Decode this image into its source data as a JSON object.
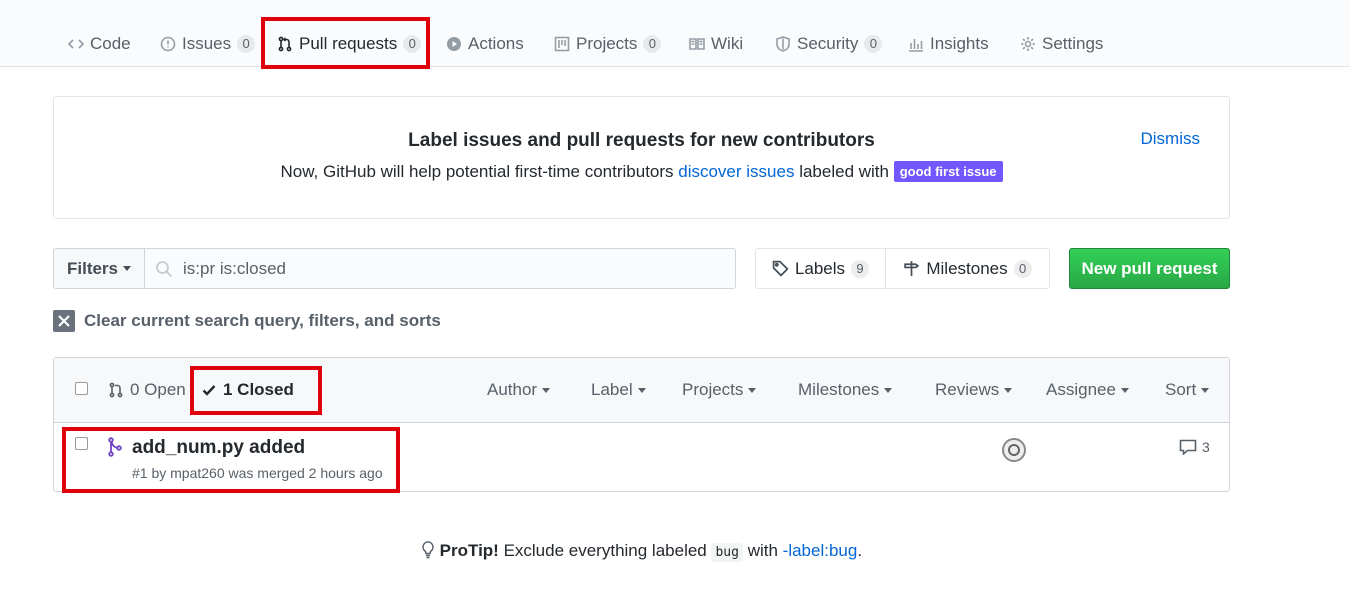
{
  "nav": {
    "tabs": [
      {
        "label": "Code",
        "icon": "code-icon"
      },
      {
        "label": "Issues",
        "count": "0",
        "icon": "issue-icon"
      },
      {
        "label": "Pull requests",
        "count": "0",
        "icon": "pull-request-icon",
        "selected": true
      },
      {
        "label": "Actions",
        "icon": "play-icon"
      },
      {
        "label": "Projects",
        "count": "0",
        "icon": "project-icon"
      },
      {
        "label": "Wiki",
        "icon": "book-icon"
      },
      {
        "label": "Security",
        "count": "0",
        "icon": "shield-icon"
      },
      {
        "label": "Insights",
        "icon": "graph-icon"
      },
      {
        "label": "Settings",
        "icon": "gear-icon"
      }
    ]
  },
  "banner": {
    "title": "Label issues and pull requests for new contributors",
    "text_before": "Now, GitHub will help potential first-time contributors ",
    "link": "discover issues",
    "text_after": " labeled with ",
    "label": "good first issue",
    "label_color": "#7057ff",
    "dismiss": "Dismiss"
  },
  "filters": {
    "button": "Filters",
    "search_value": "is:pr is:closed",
    "labels": "Labels",
    "labels_count": "9",
    "milestones": "Milestones",
    "milestones_count": "0",
    "new_pr": "New pull request"
  },
  "clear_query": "Clear current search query, filters, and sorts",
  "issues": {
    "open_label": "0 Open",
    "closed_label": "1 Closed",
    "menus": [
      "Author",
      "Label",
      "Projects",
      "Milestones",
      "Reviews",
      "Assignee",
      "Sort"
    ],
    "rows": [
      {
        "title": "add_num.py added",
        "meta": "#1 by mpat260 was merged 2 hours ago",
        "comments": "3"
      }
    ]
  },
  "protip": {
    "lead": "ProTip!",
    "text": " Exclude everything labeled ",
    "code": "bug",
    "with": " with ",
    "link": "-label:bug",
    "end": "."
  },
  "colors": {
    "accent_red_highlight": "#e0000b",
    "primary_green": "#28a745",
    "merged_purple": "#6f42c1",
    "link_blue": "#0366d6"
  }
}
